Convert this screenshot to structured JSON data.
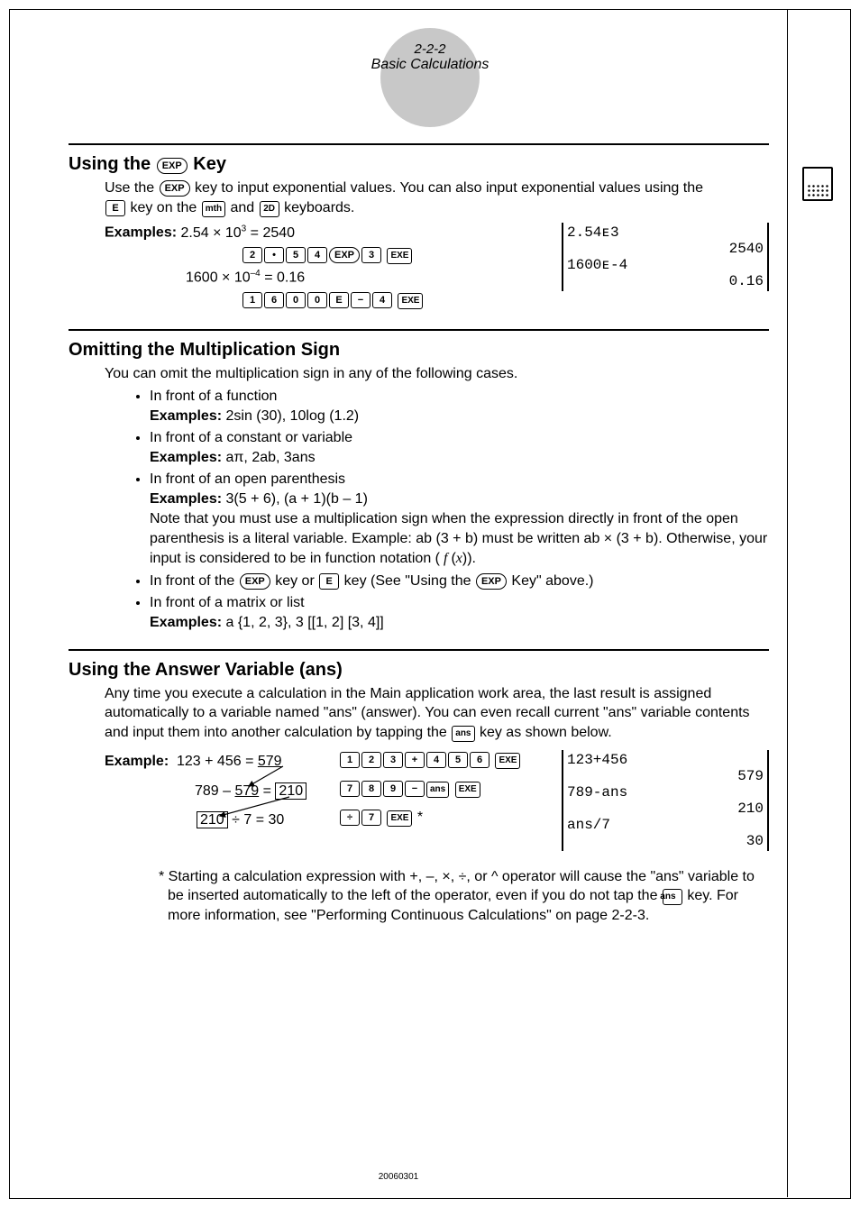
{
  "header": {
    "pagenum": "2-2-2",
    "title": "Basic Calculations"
  },
  "sec1": {
    "heading": "Using the",
    "heading_suffix": "Key",
    "intro_a": "Use the ",
    "intro_b": " key to input exponential values. You can also input exponential values using the",
    "intro_c": " key on the ",
    "intro_d": " and ",
    "intro_e": " keyboards.",
    "examples_label": "Examples:",
    "ex1_eq": "2.54 × 10³ = 2540",
    "ex2_eq": "1600 × 10⁻⁴ = 0.16",
    "screen_l1": "2.54ᴇ3",
    "screen_r1": "2540",
    "screen_l2": "1600ᴇ-4",
    "screen_r2": "0.16"
  },
  "sec2": {
    "heading": "Omitting the Multiplication Sign",
    "intro": "You can omit the multiplication sign in any of the following cases.",
    "b1": "In front of a function",
    "b1ex_label": "Examples:",
    "b1ex": " 2sin (30), 10log (1.2)",
    "b2": "In front of a constant or variable",
    "b2ex_label": "Examples:",
    "b2ex": " aπ, 2ab, 3ans",
    "b3": "In front of an open parenthesis",
    "b3ex_label": "Examples:",
    "b3ex": " 3(5 + 6), (a + 1)(b – 1)",
    "b3_note_a": "Note that you must use a multiplication sign when the expression directly in front of the open parenthesis is a literal variable. Example: ab (3 + b) must be written ab × (3 + b). Otherwise, your input is considered to be in function notation (",
    "b3_note_b": ").",
    "b4_a": "In front of the ",
    "b4_b": " key or ",
    "b4_c": " key (See \"Using the ",
    "b4_d": " Key\" above.)",
    "b5": "In front of a matrix or list",
    "b5ex_label": "Examples:",
    "b5ex": " a {1, 2, 3}, 3 [[1, 2] [3, 4]]"
  },
  "sec3": {
    "heading": "Using the Answer Variable (ans)",
    "intro_a": "Any time you execute a calculation in the Main application work area, the last result is assigned automatically to a variable named \"ans\" (answer). You can even recall current \"ans\" variable contents and input them into another calculation by tapping the ",
    "intro_b": " key as shown below.",
    "example_label": "Example:",
    "line1": "123 + 456 = 579",
    "line2_a": "789 – ",
    "line2_b": "579",
    "line2_c": " = ",
    "line2_d": "210",
    "line3_a": "210",
    "line3_b": " ÷ 7 = 30",
    "screen_l1": "123+456",
    "screen_r1": "579",
    "screen_l2": "789-ans",
    "screen_r2": "210",
    "screen_l3": "ans/7",
    "screen_r3": "30",
    "footnote_a": "* Starting a calculation expression with +, –, ×, ÷, or ^ operator will cause the \"ans\" variable to be inserted automatically to the left of the operator, even if you do not tap the ",
    "footnote_b": " key. For more information, see \"Performing Continuous Calculations\" on page 2-2-3."
  },
  "keys": {
    "EXP": "EXP",
    "E": "E",
    "mth": "mth",
    "2D": "2D",
    "ans": "ans",
    "EXE": "EXE",
    "minus": "−",
    "plus": "+",
    "div": "÷",
    "dot": "•",
    "d2": "2",
    "d5": "5",
    "d4": "4",
    "d3": "3",
    "d1": "1",
    "d6": "6",
    "d0": "0",
    "d7": "7",
    "d8": "8",
    "d9": "9",
    "neg": "(−)"
  },
  "footer": "20060301"
}
